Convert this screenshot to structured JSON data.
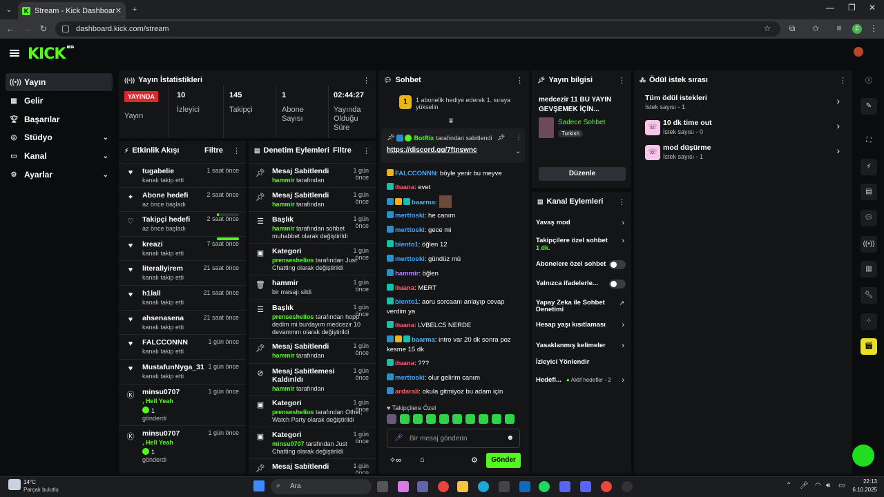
{
  "browser": {
    "tab_title": "Stream - Kick Dashboard",
    "url": "dashboard.kick.com/stream",
    "profile_letter": "F"
  },
  "app": {
    "logo": "KICK",
    "logo_badge": "BETA"
  },
  "sidebar": {
    "items": [
      {
        "label": "Yayın",
        "icon": "broadcast-icon",
        "active": true
      },
      {
        "label": "Gelir",
        "icon": "chart-icon"
      },
      {
        "label": "Başarılar",
        "icon": "trophy-icon"
      },
      {
        "label": "Stüdyo",
        "icon": "studio-icon",
        "chevron": true
      },
      {
        "label": "Kanal",
        "icon": "channel-icon",
        "chevron": true
      },
      {
        "label": "Ayarlar",
        "icon": "gear-icon",
        "chevron": true
      }
    ]
  },
  "stats": {
    "title": "Yayın İstatistikleri",
    "live_badge": "YAYINDA",
    "live_label": "Yayın",
    "cells": [
      {
        "value": "10",
        "label": "İzleyici"
      },
      {
        "value": "145",
        "label": "Takipçi"
      },
      {
        "value": "1",
        "label": "Abone Sayısı"
      },
      {
        "value": "02:44:27",
        "label": "Yayında Olduğu Süre"
      }
    ]
  },
  "activity": {
    "title": "Etkinlik Akışı",
    "filter": "Filtre",
    "items": [
      {
        "name": "tugabelie",
        "sub": "kanalı takip etti",
        "time": "1 saat önce",
        "icon": "heart-icon"
      },
      {
        "name": "Abone hedefi",
        "sub": "az önce başladı",
        "time": "2 saat önce",
        "icon": "sparkle-icon",
        "progress": 0.1
      },
      {
        "name": "Takipçi hedefi",
        "sub": "az önce başladı",
        "time": "2 saat önce",
        "icon": "heart-outline-icon",
        "progress": 1
      },
      {
        "name": "kreazi",
        "sub": "kanalı takip etti",
        "time": "7 saat önce",
        "icon": "heart-icon"
      },
      {
        "name": "literallyirem",
        "sub": "kanalı takip etti",
        "time": "21 saat önce",
        "icon": "heart-icon"
      },
      {
        "name": "h1lall",
        "sub": "kanalı takip etti",
        "time": "21 saat önce",
        "icon": "heart-icon"
      },
      {
        "name": "ahsenasena",
        "sub": "kanalı takip etti",
        "time": "21 saat önce",
        "icon": "heart-icon"
      },
      {
        "name": "FALCCONNN",
        "sub": "kanalı takip etti",
        "time": "1 gün önce",
        "icon": "heart-icon"
      },
      {
        "name": "MustafunNyga_31",
        "sub": "kanalı takip etti",
        "time": "1 gün önce",
        "icon": "heart-icon"
      },
      {
        "name": "minsu0707",
        "line2": ", Hell Yeah",
        "count": "1",
        "sub": "gönderdi",
        "time": "1 gün önce",
        "icon": "kick-coin-icon"
      },
      {
        "name": "minsu0707",
        "line2": ", Hell Yeah",
        "count": "1",
        "sub": "gönderdi",
        "time": "1 gün önce",
        "icon": "kick-coin-icon"
      }
    ]
  },
  "moderation": {
    "title": "Denetim Eylemleri",
    "filter": "Filtre",
    "items": [
      {
        "name": "Mesaj Sabitlendi",
        "user": "hammir",
        "rest": " tarafından",
        "time": "1 gün önce",
        "icon": "pin-icon"
      },
      {
        "name": "Mesaj Sabitlendi",
        "user": "hammir",
        "rest": " tarafından",
        "time": "1 gün önce",
        "icon": "pin-icon"
      },
      {
        "name": "Başlık",
        "user": "hammir",
        "rest": " tarafından sohbet muhabbet olarak değiştirildi",
        "time": "1 gün önce",
        "icon": "title-icon"
      },
      {
        "name": "Kategori",
        "user": "prenseshelios",
        "rest": " tarafından Just Chatting olarak değiştirildi",
        "time": "1 gün önce",
        "icon": "category-icon"
      },
      {
        "name": "hammir",
        "user": "",
        "rest": "bir mesajı sildi",
        "time": "1 gün önce",
        "icon": "trash-icon"
      },
      {
        "name": "Başlık",
        "user": "prenseshelios",
        "rest": " tarafından hopp dedim mi burdayım medcezir 10 devammm olarak değiştirildi",
        "time": "1 gün önce",
        "icon": "title-icon"
      },
      {
        "name": "Mesaj Sabitlendi",
        "user": "hammir",
        "rest": " tarafından",
        "time": "1 gün önce",
        "icon": "pin-icon"
      },
      {
        "name": "Mesaj Sabitlemesi Kaldırıldı",
        "user": "hammir",
        "rest": " tarafından",
        "time": "1 gün önce",
        "icon": "unpin-icon"
      },
      {
        "name": "Kategori",
        "user": "prenseshelios",
        "rest": " tarafından Other, Watch Party olarak değiştirildi",
        "time": "1 gün önce",
        "icon": "category-icon"
      },
      {
        "name": "Kategori",
        "user": "minsu0707",
        "rest": " tarafından Just Chatting olarak değiştirildi",
        "time": "1 gün önce",
        "icon": "category-icon"
      },
      {
        "name": "Mesaj Sabitlendi",
        "user": "",
        "rest": "",
        "time": "1 gün önce",
        "icon": "pin-icon"
      }
    ]
  },
  "chat": {
    "title": "Sohbet",
    "gift_banner": "1 abonelik hediye ederek 1. sıraya yükselin",
    "gift_rank": "1",
    "pinned": {
      "user": "BotRix",
      "by": "tarafından sabitlendi",
      "link": "https://discord.gg/7ftnswnc"
    },
    "messages": [
      {
        "user": "FALCCONNN",
        "cls": "u-blue",
        "badges": [
          "bd-c"
        ],
        "text": ": böyle yenir bu meyve"
      },
      {
        "user": "ituana",
        "cls": "u-pink",
        "badges": [
          "bd-b"
        ],
        "text": ": evet"
      },
      {
        "user": "baarma",
        "cls": "u-cyan",
        "badges": [
          "bd-a",
          "bd-c",
          "bd-b"
        ],
        "text": ":"
      },
      {
        "user": "merttoski",
        "cls": "u-blue",
        "badges": [
          "bd-a"
        ],
        "text": ": he canım"
      },
      {
        "user": "merttoski",
        "cls": "u-blue",
        "badges": [
          "bd-a"
        ],
        "text": ": gece mi"
      },
      {
        "user": "biento1",
        "cls": "u-blue",
        "badges": [
          "bd-b"
        ],
        "text": ": öğlen 12"
      },
      {
        "user": "merttoski",
        "cls": "u-blue",
        "badges": [
          "bd-a"
        ],
        "text": ": gündüz mü"
      },
      {
        "user": "hammir",
        "cls": "u-purple",
        "badges": [
          "bd-a"
        ],
        "text": ": öğlen"
      },
      {
        "user": "ituana",
        "cls": "u-pink",
        "badges": [
          "bd-b"
        ],
        "text": ": MERT"
      },
      {
        "user": "biento1",
        "cls": "u-blue",
        "badges": [
          "bd-b"
        ],
        "text": ": aoru sorcaanı anlayıp cevap verdim ya"
      },
      {
        "user": "ituana",
        "cls": "u-pink",
        "badges": [
          "bd-b"
        ],
        "text": ": LVBELC5 NERDE"
      },
      {
        "user": "baarma",
        "cls": "u-cyan",
        "badges": [
          "bd-a",
          "bd-c",
          "bd-b"
        ],
        "text": ": intro var 20 dk sonra poz kesme 15 dk"
      },
      {
        "user": "ituana",
        "cls": "u-pink",
        "badges": [
          "bd-b"
        ],
        "text": ": ???"
      },
      {
        "user": "merttoski",
        "cls": "u-blue",
        "badges": [
          "bd-a"
        ],
        "text": ": olur gelirim canım"
      },
      {
        "user": "ardarali",
        "cls": "u-red",
        "badges": [
          "bd-a"
        ],
        "text": ": okula gitmiyoz bu adam için"
      }
    ],
    "followers_only": "Takipçilere Özel",
    "input_placeholder": "Bir mesaj gönderin",
    "send": "Gönder"
  },
  "stream_info": {
    "title": "Yayın bilgisi",
    "stream_title": "medcezir 11 BU YAYIN GEVŞEMEK İÇİN...",
    "category": "Sadece Sohbet",
    "tag": "Turkish",
    "edit": "Düzenle"
  },
  "channel_actions": {
    "title": "Kanal Eylemleri",
    "items": [
      {
        "label": "Yavaş mod",
        "type": "chevron"
      },
      {
        "label": "Takipçilere özel sohbet",
        "extra": "1 dk.",
        "type": "chevron"
      },
      {
        "label": "Abonelere özel sohbet",
        "type": "toggle"
      },
      {
        "label": "Yalnızca ifadelerle...",
        "type": "toggle"
      },
      {
        "label": "Yapay Zeka ile Sohbet Denetimi",
        "type": "external"
      },
      {
        "label": "Hesap yaşı kısıtlaması",
        "type": "chevron"
      },
      {
        "label": "Yasaklanmış kelimeler",
        "type": "chevron"
      },
      {
        "label": "İzleyici Yönlendir",
        "type": "none"
      },
      {
        "label": "Hedefl...",
        "extra": "Aktif hedefler - 2",
        "type": "chevron"
      }
    ]
  },
  "rewards": {
    "title": "Ödül istek sırası",
    "items": [
      {
        "name": "Tüm ödül istekleri",
        "sub": "İstek sayısı - 1"
      },
      {
        "name": "10 dk time out",
        "sub": "İstek sayısı - 0"
      },
      {
        "name": "mod düşürme",
        "sub": "İstek sayısı - 1"
      }
    ]
  },
  "taskbar": {
    "weather_temp": "14°C",
    "weather_desc": "Parçalı bulutlu",
    "search": "Ara",
    "time": "22:13",
    "date": "6.10.2025"
  },
  "colors": {
    "accent": "#53fc18",
    "live": "#e0252f"
  }
}
